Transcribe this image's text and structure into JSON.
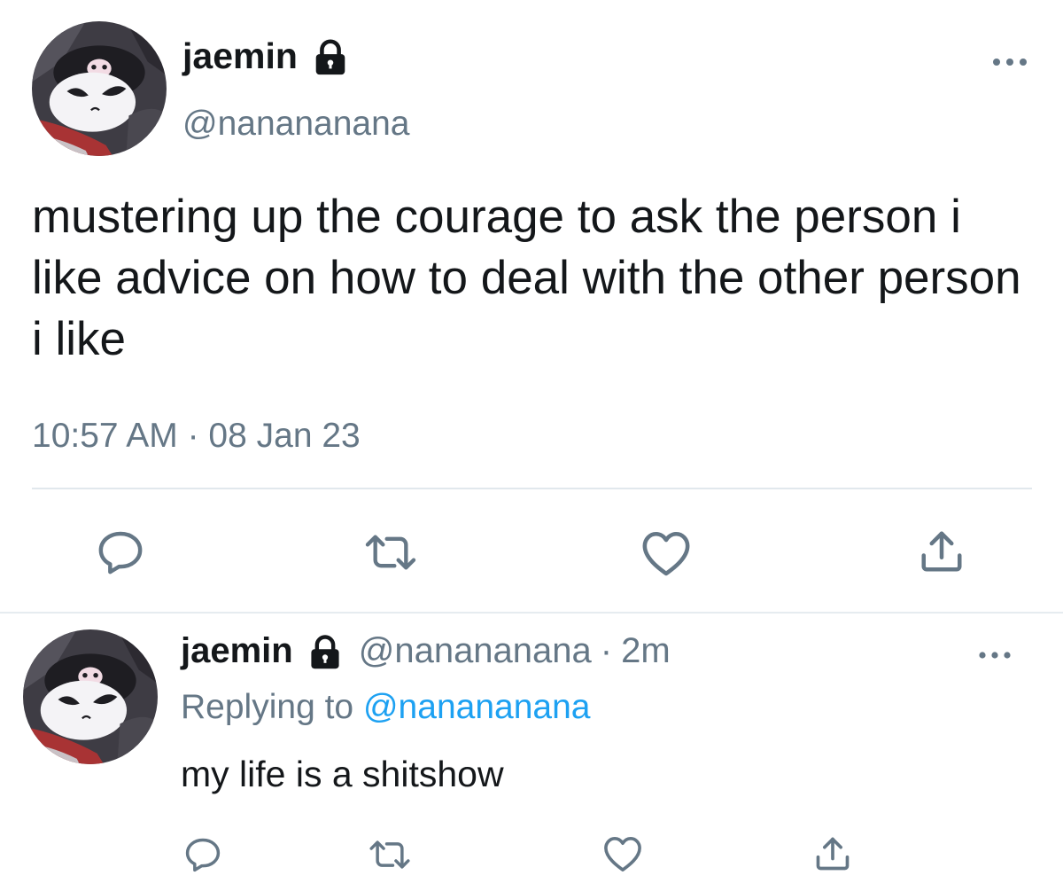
{
  "main_tweet": {
    "display_name": "jaemin",
    "handle": "@nanananana",
    "text": "mustering up the courage to ask the person i like advice on how to deal with the other person i like",
    "timestamp": "10:57 AM · 08 Jan 23",
    "icons": {
      "more": "more-horizontal-icon",
      "reply": "reply-icon",
      "retweet": "retweet-icon",
      "like": "heart-icon",
      "share": "share-icon",
      "lock": "lock-icon"
    }
  },
  "reply_tweet": {
    "display_name": "jaemin",
    "handle": "@nanananana",
    "separator": "·",
    "age": "2m",
    "replying_label": "Replying to",
    "replying_handle": "@nanananana",
    "text": "my life is a shitshow"
  },
  "colors": {
    "text_primary": "#14171a",
    "text_secondary": "#657786",
    "link": "#1da1f2",
    "icon": "#657786",
    "divider": "#e1e8ed"
  }
}
